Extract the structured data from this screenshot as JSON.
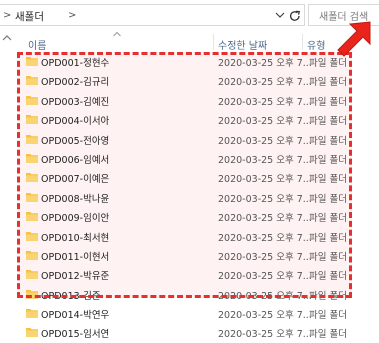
{
  "address": {
    "folder": "새폴더",
    "separator": ">"
  },
  "search": {
    "placeholder": "새폴더 검색"
  },
  "columns": {
    "name": "이름",
    "date": "수정한 날짜",
    "type": "유형"
  },
  "rows": [
    {
      "name": "OPD001-정현수",
      "date": "2020-03-25 오후 7...",
      "type": "파일 폴더"
    },
    {
      "name": "OPD002-김규리",
      "date": "2020-03-25 오후 7...",
      "type": "파일 폴더"
    },
    {
      "name": "OPD003-김예진",
      "date": "2020-03-25 오후 7...",
      "type": "파일 폴더"
    },
    {
      "name": "OPD004-이서아",
      "date": "2020-03-25 오후 7...",
      "type": "파일 폴더"
    },
    {
      "name": "OPD005-전아영",
      "date": "2020-03-25 오후 7...",
      "type": "파일 폴더"
    },
    {
      "name": "OPD006-임예서",
      "date": "2020-03-25 오후 7...",
      "type": "파일 폴더"
    },
    {
      "name": "OPD007-이예은",
      "date": "2020-03-25 오후 7...",
      "type": "파일 폴더"
    },
    {
      "name": "OPD008-박나윤",
      "date": "2020-03-25 오후 7...",
      "type": "파일 폴더"
    },
    {
      "name": "OPD009-임이안",
      "date": "2020-03-25 오후 7...",
      "type": "파일 폴더"
    },
    {
      "name": "OPD010-최서현",
      "date": "2020-03-25 오후 7...",
      "type": "파일 폴더"
    },
    {
      "name": "OPD011-이현서",
      "date": "2020-03-25 오후 7...",
      "type": "파일 폴더"
    },
    {
      "name": "OPD012-박유준",
      "date": "2020-03-25 오후 7...",
      "type": "파일 폴더"
    },
    {
      "name": "OPD013-김준",
      "date": "2020-03-25 오후 7...",
      "type": "파일 폴더"
    },
    {
      "name": "OPD014-박연우",
      "date": "2020-03-25 오후 7...",
      "type": "파일 폴더"
    },
    {
      "name": "OPD015-임서연",
      "date": "2020-03-25 오후 7...",
      "type": "파일 폴더"
    }
  ],
  "colors": {
    "highlight": "#e53030",
    "folder": "#f5c242",
    "header_text": "#4d6a8a"
  },
  "icons": {
    "folder": "folder-icon",
    "refresh": "refresh-icon",
    "chevron": "chevron-down-icon",
    "arrow": "red-arrow-icon"
  }
}
